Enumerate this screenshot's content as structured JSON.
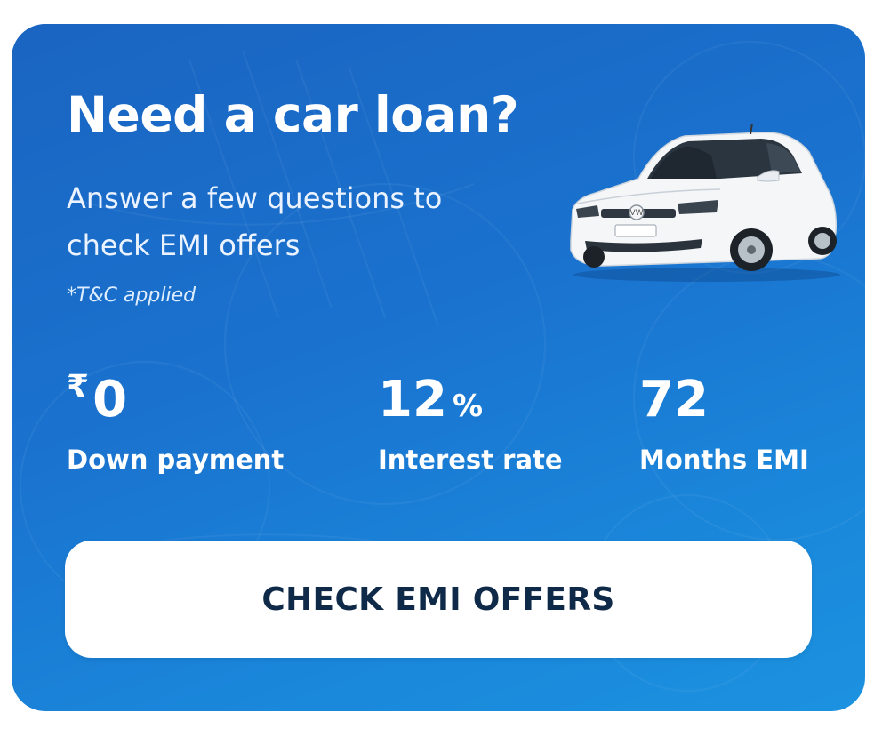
{
  "promo": {
    "title": "Need a car loan?",
    "subtitle": "Answer a few questions to check EMI offers",
    "disclaimer": "*T&C applied",
    "car_image": "white-hatchback-car"
  },
  "stats": [
    {
      "prefix": "₹",
      "value": "0",
      "suffix": "",
      "label": "Down payment"
    },
    {
      "prefix": "",
      "value": "12",
      "suffix": "%",
      "label": "Interest rate"
    },
    {
      "prefix": "",
      "value": "72",
      "suffix": "",
      "label": "Months EMI"
    }
  ],
  "cta": {
    "label": "CHECK EMI OFFERS"
  },
  "colors": {
    "card_gradient_start": "#1a64c1",
    "card_gradient_end": "#1c92e0",
    "cta_background": "#ffffff",
    "cta_text": "#0f2a48"
  }
}
